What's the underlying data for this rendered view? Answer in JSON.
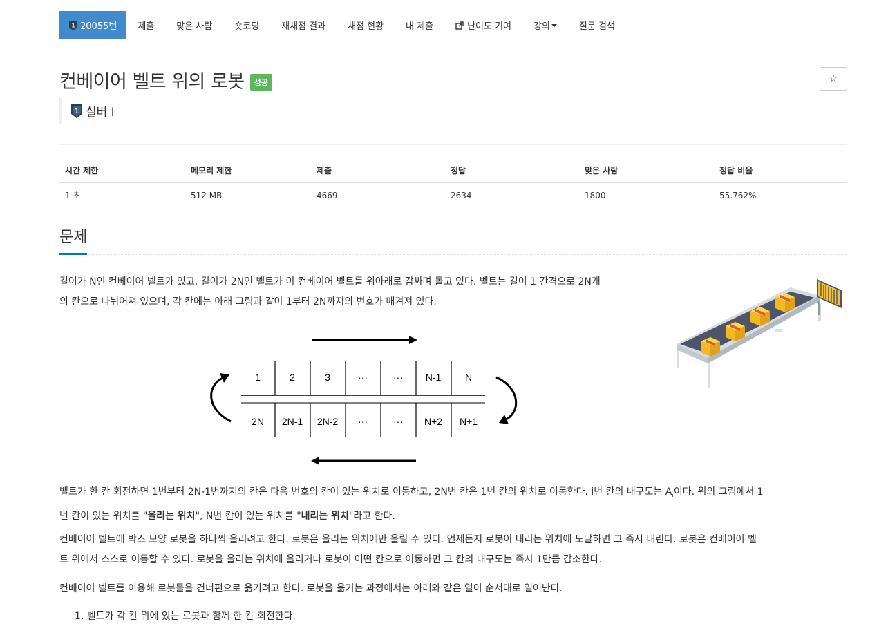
{
  "nav": {
    "problem_number": "20055번",
    "items": [
      "제출",
      "맞은 사람",
      "숏코딩",
      "재채점 결과",
      "채점 현황",
      "내 제출",
      "난이도 기여",
      "강의",
      "질문 검색"
    ]
  },
  "problem": {
    "title": "컨베이어 벨트 위의 로봇",
    "status_badge": "성공",
    "star": "☆",
    "tier": "실버 I",
    "tier_number": "1"
  },
  "info": {
    "headers": [
      "시간 제한",
      "메모리 제한",
      "제출",
      "정답",
      "맞은 사람",
      "정답 비율"
    ],
    "values": [
      "1 초",
      "512 MB",
      "4669",
      "2634",
      "1800",
      "55.762%"
    ]
  },
  "section": {
    "title": "문제"
  },
  "text": {
    "p1_line1": "길이가 N인 컨베이어 벨트가 있고, 길이가 2N인 벨트가 이 컨베이어 벨트를 위아래로 감싸며 돌고 있다. 벨트는 길이 1 간격으로 2N개",
    "p1_line2": "의 칸으로 나뉘어져 있으며, 각 칸에는 아래 그림과 같이 1부터 2N까지의 번호가 매겨져 있다.",
    "p2_a": "벨트가 한 칸 회전하면 1번부터 2N-1번까지의 칸은 다음 번호의 칸이 있는 위치로 이동하고, 2N번 칸은 1번 칸의 위치로 이동한다. i번 칸의 내구도는 A",
    "p2_sub": "i",
    "p2_b": "이다. 위의 그림에서 1",
    "p2_c": "번 칸이 있는 위치를 \"",
    "p2_bold1": "올리는 위치",
    "p2_d": "\", N번 칸이 있는 위치를 \"",
    "p2_bold2": "내리는 위치",
    "p2_e": "\"라고 한다.",
    "p3_line1": "컨베이어 벨트에 박스 모양 로봇을 하나씩 올리려고 한다. 로봇은 올리는 위치에만 올릴 수 있다. 언제든지 로봇이 내리는 위치에 도달하면 그 즉시 내린다. 로봇은 컨베이어 벨",
    "p3_line2": "트 위에서 스스로 이동할 수 있다. 로봇을 올리는 위치에 올리거나 로봇이 어떤 칸으로 이동하면 그 칸의 내구도는 즉시 1만큼 감소한다.",
    "p4": "컨베이어 벨트를 이용해 로봇들을 건너편으로 옮기려고 한다. 로봇을 옮기는 과정에서는 아래와 같은 일이 순서대로 일어난다.",
    "list1": "1. 벨트가 각 칸 위에 있는 로봇과 함께 한 칸 회전한다."
  },
  "diagram": {
    "top_cells": [
      "1",
      "2",
      "3",
      "···",
      "···",
      "N-1",
      "N"
    ],
    "bottom_cells": [
      "2N",
      "2N-1",
      "2N-2",
      "···",
      "···",
      "N+2",
      "N+1"
    ]
  },
  "colors": {
    "accent": "#428bca",
    "success": "#5cb85c",
    "underline": "#0076c0"
  }
}
